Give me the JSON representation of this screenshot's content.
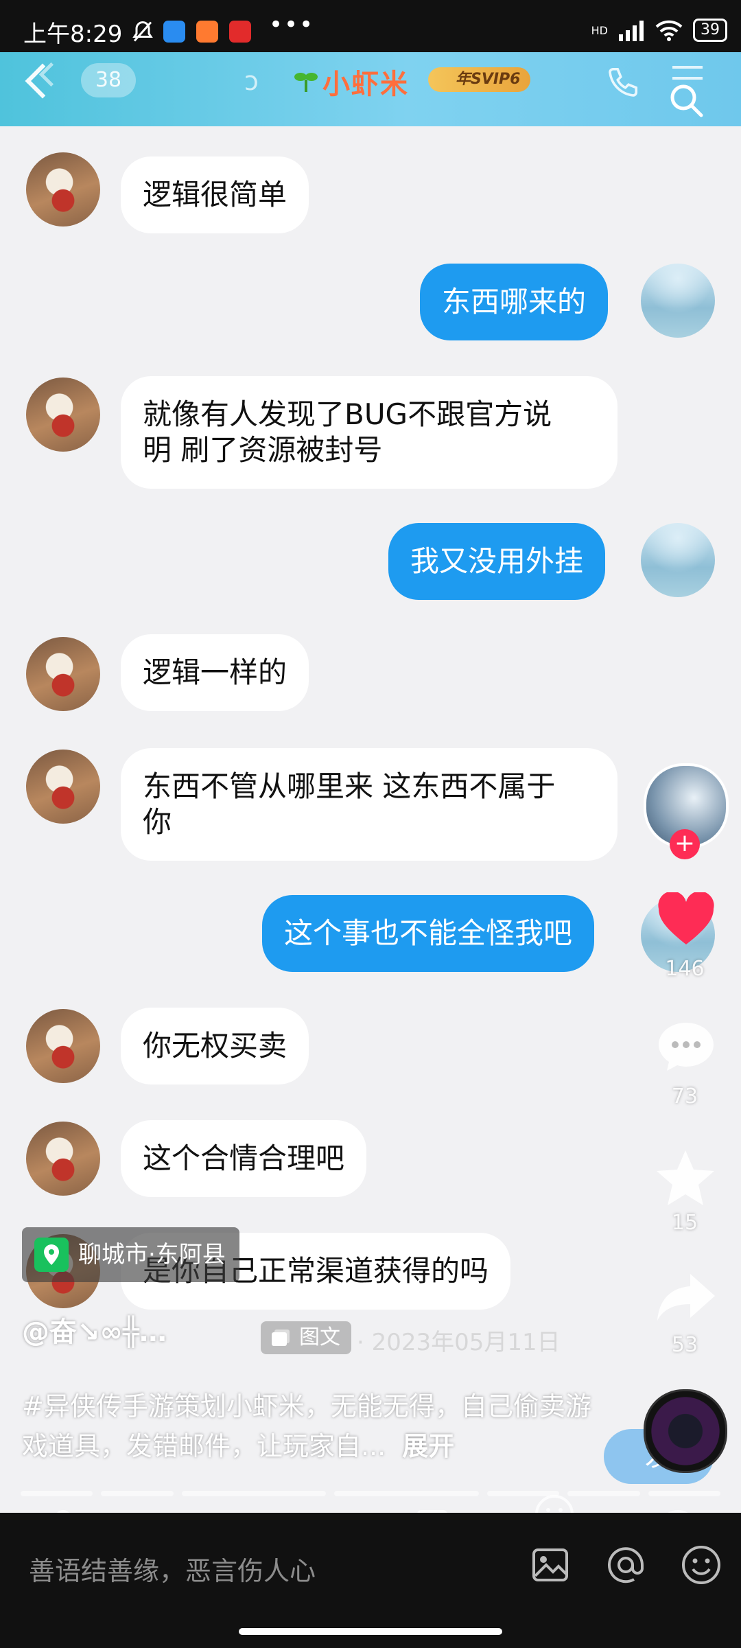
{
  "status_bar": {
    "time": "上午8:29",
    "battery": "39",
    "network": "HD"
  },
  "chat_header": {
    "unread_count": "38",
    "nickname": "小虾米",
    "svip_badge": "年SVIP6"
  },
  "messages": [
    {
      "side": "left",
      "text": "逻辑很简单"
    },
    {
      "side": "right",
      "text": "东西哪来的"
    },
    {
      "side": "left",
      "text": "就像有人发现了BUG不跟官方说\n明 刷了资源被封号"
    },
    {
      "side": "right",
      "text": "我又没用外挂"
    },
    {
      "side": "left",
      "text": "逻辑一样的"
    },
    {
      "side": "left",
      "text": "东西不管从哪里来 这东西不属于\n你"
    },
    {
      "side": "right",
      "text": "这个事也不能全怪我吧"
    },
    {
      "side": "left",
      "text": "你无权买卖"
    },
    {
      "side": "left",
      "text": "这个合情合理吧"
    },
    {
      "side": "left",
      "text": "是你自己正常渠道获得的吗"
    }
  ],
  "chat_input": {
    "send_label": "发"
  },
  "video": {
    "likes": "146",
    "comments": "73",
    "favorites": "15",
    "shares": "53",
    "location": "聊城市·东阿县",
    "author": "@奋↘∞╬…",
    "type_tag": "图文",
    "date": "· 2023年05月11日",
    "description": "#异侠传手游策划小虾米，无能无得，自己偷卖游戏道具，发错邮件，让玩家自...",
    "expand_label": "展开"
  },
  "comment_bar": {
    "placeholder": "善语结善缘，恶言伤人心"
  },
  "colors": {
    "header_bg": "#4fc3dc",
    "bubble_blue": "#1e9bf0",
    "like_red": "#fe2c55",
    "location_green": "#19c15d"
  }
}
